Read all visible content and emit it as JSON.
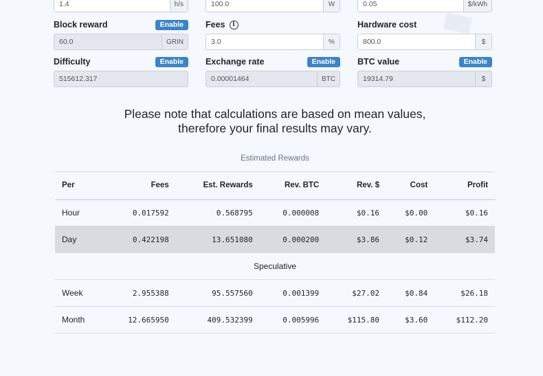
{
  "top_row": [
    {
      "value": "1.4",
      "unit": "h/s"
    },
    {
      "value": "100.0",
      "unit": "W"
    },
    {
      "value": "0.05",
      "unit": "$/kWh"
    }
  ],
  "fields": {
    "block_reward": {
      "label": "Block reward",
      "button": "Enable",
      "value": "60.0",
      "unit": "GRIN"
    },
    "fees": {
      "label": "Fees",
      "icon": "info-icon",
      "value": "3.0",
      "unit": "%"
    },
    "hardware_cost": {
      "label": "Hardware cost",
      "value": "800.0",
      "unit": "$"
    },
    "difficulty": {
      "label": "Difficulty",
      "button": "Enable",
      "value": "515612.317"
    },
    "exchange_rate": {
      "label": "Exchange rate",
      "button": "Enable",
      "value": "0.00001464",
      "unit": "BTC"
    },
    "btc_value": {
      "label": "BTC value",
      "button": "Enable",
      "value": "19314.79",
      "unit": "$"
    }
  },
  "notice": {
    "line1": "Please note that calculations are based on mean values,",
    "line2": "therefore your final results may vary."
  },
  "table": {
    "caption": "Estimated Rewards",
    "headers": [
      "Per",
      "Fees",
      "Est. Rewards",
      "Rev. BTC",
      "Rev. $",
      "Cost",
      "Profit"
    ],
    "rows": [
      [
        "Hour",
        "0.017592",
        "0.568795",
        "0.000008",
        "$0.16",
        "$0.00",
        "$0.16"
      ],
      [
        "Day",
        "0.422198",
        "13.651080",
        "0.000200",
        "$3.86",
        "$0.12",
        "$3.74"
      ]
    ],
    "section": "Speculative",
    "speculative_rows": [
      [
        "Week",
        "2.955388",
        "95.557560",
        "0.001399",
        "$27.02",
        "$0.84",
        "$26.18"
      ],
      [
        "Month",
        "12.665950",
        "409.532399",
        "0.005996",
        "$115.80",
        "$3.60",
        "$112.20"
      ]
    ]
  },
  "colors": {
    "accent": "#3d84c6",
    "background": "#f5f8fc",
    "row_shade": "#d9dcdf"
  }
}
